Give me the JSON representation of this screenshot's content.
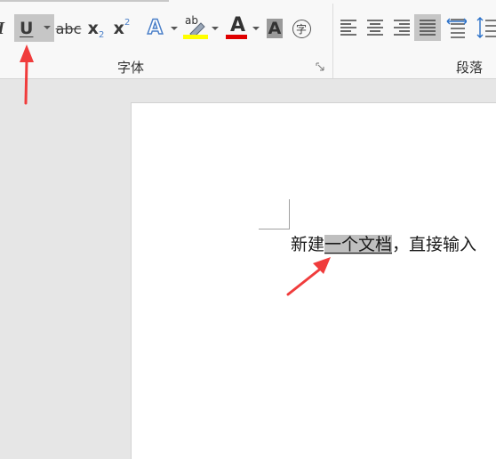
{
  "ribbon": {
    "font_group_label": "字体",
    "paragraph_group_label": "段落",
    "buttons": {
      "italic": "I",
      "underline": "U",
      "strikethrough": "abc",
      "subscript_base": "x",
      "subscript_mark": "2",
      "superscript_base": "x",
      "superscript_mark": "2",
      "text_effects": "A",
      "highlight": "ab",
      "font_color": "A",
      "char_shading": "A",
      "enclose_char": "字"
    }
  },
  "document": {
    "before_selection": "新建",
    "selection": "一个文档",
    "after_selection": "，直接输入"
  },
  "colors": {
    "highlight_yellow": "#ffff00",
    "font_red": "#e00000",
    "annotation_red": "#f03c3c",
    "text_effects_blue": "#4a7fc8"
  }
}
